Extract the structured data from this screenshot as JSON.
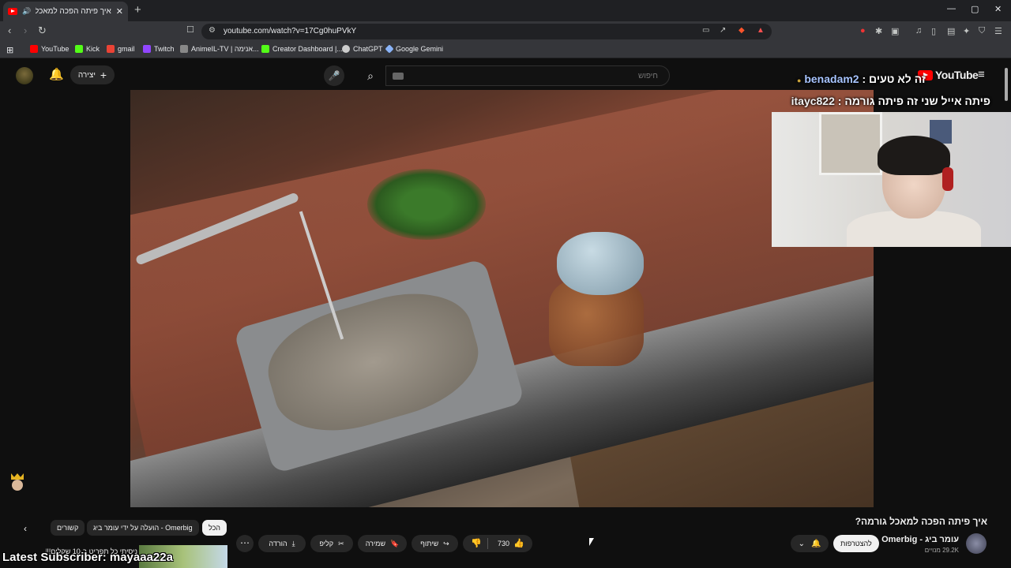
{
  "browser": {
    "tab_title": "איך פיתה הפכה למאכל גורמה",
    "tab_close": "✕",
    "new_tab": "+",
    "url": "youtube.com/watch?v=17Cg0huPVkY",
    "window_controls": [
      "—",
      "▢",
      "✕"
    ]
  },
  "bookmarks": [
    {
      "label": "YouTube",
      "color": "#ff0000"
    },
    {
      "label": "Kick",
      "color": "#53fc18"
    },
    {
      "label": "gmail",
      "color": "#ea4335"
    },
    {
      "label": "Twitch",
      "color": "#9146ff"
    },
    {
      "label": "AnimeIL-TV | אנימה...",
      "color": "#888888"
    },
    {
      "label": "Creator Dashboard |...",
      "color": "#53fc18"
    },
    {
      "label": "ChatGPT",
      "color": "#cccccc"
    },
    {
      "label": "Google Gemini",
      "color": "#8ab4f8"
    }
  ],
  "youtube": {
    "create_label": "יצירה",
    "search_placeholder": "חיפוש",
    "logo": "YouTube"
  },
  "chat": [
    {
      "user": "benadam2",
      "message": "זה לא טעים"
    },
    {
      "user": "itayc822",
      "message": "פיתה אייל שני זה פיתה גורמה"
    }
  ],
  "video": {
    "title": "איך פיתה הפכה למאכל גורמה?",
    "channel": "עומר ביג - Omerbig",
    "subscribers": "29.2K מנויים",
    "subscribe_label": "להצטרפות",
    "like_count": "730",
    "share_label": "שיתוף",
    "save_label": "שמירה",
    "clip_label": "קליפ",
    "download_label": "הורדה"
  },
  "chips": [
    {
      "label": "הכל",
      "active": true
    },
    {
      "label": "הועלה על ידי עומר ביג - Omerbig",
      "active": false
    },
    {
      "label": "קשורים",
      "active": false
    }
  ],
  "recommendation": {
    "title": "ניסיתי כל תפריט ב-10 שקלים!!!"
  },
  "overlay": {
    "latest_subscriber": "Latest Subscriber: mayaaa22a"
  }
}
